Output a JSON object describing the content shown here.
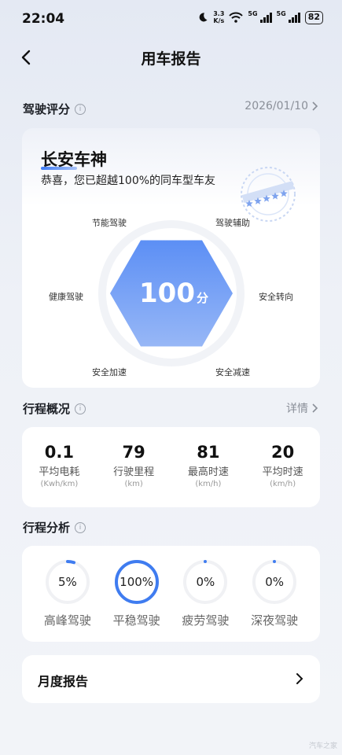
{
  "status_bar": {
    "time": "22:04",
    "net_speed_value": "3.3",
    "net_speed_unit": "K/s",
    "signal1_label": "5G",
    "signal2_label": "5G",
    "battery": "82"
  },
  "header": {
    "title": "用车报告"
  },
  "driving_score": {
    "section_title": "驾驶评分",
    "date": "2026/01/10",
    "title": "长安车神",
    "description": "恭喜，您已超越100%的同车型车友",
    "score": "100",
    "score_unit": "分",
    "dimensions": [
      "节能驾驶",
      "驾驶辅助",
      "安全转向",
      "安全减速",
      "安全加速",
      "健康驾驶"
    ],
    "dimension_levels": [
      1,
      1,
      1,
      1,
      1,
      1
    ],
    "badge_stars": 5,
    "accent_color": "#4f86f7"
  },
  "trip_overview": {
    "section_title": "行程概况",
    "detail_link": "详情",
    "stats": [
      {
        "value": "0.1",
        "label": "平均电耗",
        "unit": "(Kwh/km)"
      },
      {
        "value": "79",
        "label": "行驶里程",
        "unit": "(km)"
      },
      {
        "value": "81",
        "label": "最高时速",
        "unit": "(km/h)"
      },
      {
        "value": "20",
        "label": "平均时速",
        "unit": "(km/h)"
      }
    ]
  },
  "trip_analysis": {
    "section_title": "行程分析",
    "items": [
      {
        "percent_text": "5%",
        "fraction": 0.05,
        "label": "高峰驾驶"
      },
      {
        "percent_text": "100%",
        "fraction": 1.0,
        "label": "平稳驾驶"
      },
      {
        "percent_text": "0%",
        "fraction": 0.0,
        "label": "疲劳驾驶"
      },
      {
        "percent_text": "0%",
        "fraction": 0.0,
        "label": "深夜驾驶"
      }
    ],
    "ring_color": "#3f7cf0",
    "track_color": "#f0f1f4"
  },
  "monthly_report": {
    "label": "月度报告"
  },
  "watermark": "汽车之家"
}
